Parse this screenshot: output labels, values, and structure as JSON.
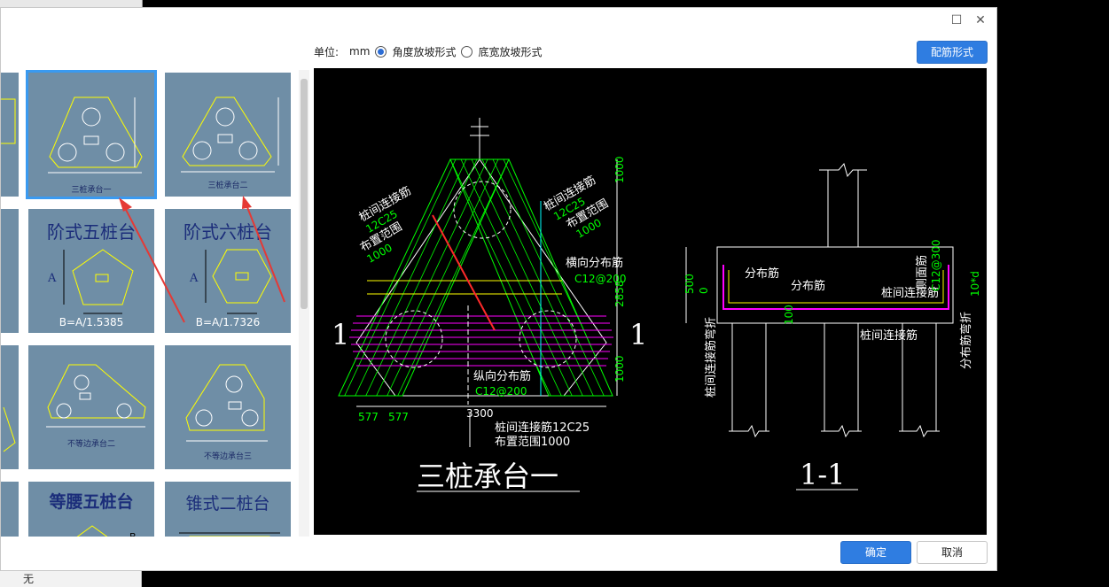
{
  "background": {
    "bottom_left_text": "无"
  },
  "dialog": {
    "maximize_glyph": "☐",
    "close_glyph": "✕",
    "unit_label": "单位:",
    "unit_value": "mm",
    "radio_angle_label": "角度放坡形式",
    "radio_width_label": "底宽放坡形式",
    "rebar_button": "配筋形式",
    "ok_button": "确定",
    "cancel_button": "取消"
  },
  "thumbnails": {
    "r1c2_caption": "三桩承台一",
    "r1c3_caption": "三桩承台二",
    "r2c2_title": "阶式五桩台",
    "r2c2_formula": "B=A/1.5385",
    "r2c3_title": "阶式六桩台",
    "r2c3_formula": "B=A/1.7326",
    "r3c2_caption": "不等边承台二",
    "r3c3_caption": "不等边承台三",
    "r4c2_title": "等腰五桩台",
    "r4c3_title": "锥式二桩台"
  },
  "drawing": {
    "plan_title": "三桩承台一",
    "section_title": "1-1",
    "section_mark": "1",
    "label_pile_conn_left": "桩间连接筋",
    "label_12c25": "12C25",
    "label_range": "布置范围",
    "label_1000": "1000",
    "label_transverse": "横向分布筋",
    "label_c12200": "C12@200",
    "label_longitudinal": "纵向分布筋",
    "label_bottom_conn": "桩间连接筋12C25",
    "label_bottom_range": "布置范围1000",
    "dim_577": "577",
    "dim_3300": "3300",
    "dim_2858": "2858",
    "sec_dist1": "分布筋",
    "sec_dist2": "分布筋",
    "sec_side": "侧面筋",
    "sec_c12": "C12@300",
    "sec_conn": "桩间连接筋",
    "sec_conn2": "桩间连接筋",
    "sec_bent": "桩间连接筋弯折",
    "sec_dist_bent": "分布筋弯折",
    "sec_500": "500",
    "sec_100": "100",
    "sec_0": "0",
    "sec_10d": "10*d"
  },
  "colors": {
    "accent": "#2f7de1",
    "thumb_bg": "#6f8ea6",
    "cad_green": "#00ff00",
    "cad_yellow": "#ffff00",
    "cad_magenta": "#ff00ff",
    "cad_cyan": "#00ffff"
  }
}
